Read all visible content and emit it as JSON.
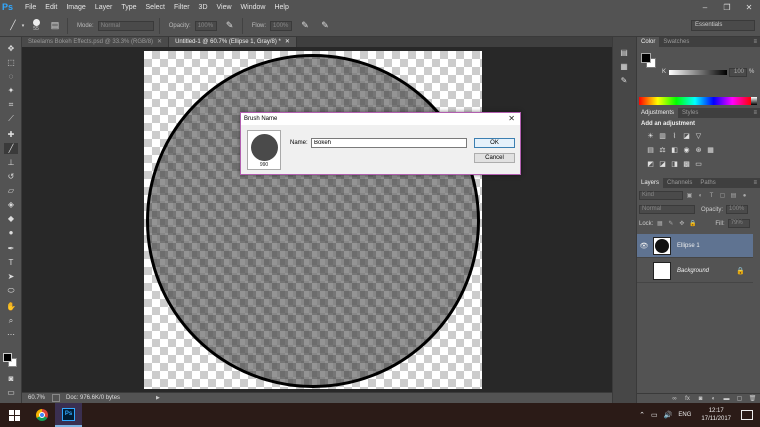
{
  "app": {
    "logo": "Ps",
    "menu": [
      "File",
      "Edit",
      "Image",
      "Layer",
      "Type",
      "Select",
      "Filter",
      "3D",
      "View",
      "Window",
      "Help"
    ],
    "window_controls": [
      "–",
      "❐",
      "✕"
    ]
  },
  "options": {
    "brush_size": "55",
    "mode_label": "Mode:",
    "mode_value": "Normal",
    "opacity_label": "Opacity:",
    "opacity_value": "100%",
    "flow_label": "Flow:",
    "flow_value": "100%",
    "workspace": "Essentials"
  },
  "tabs": [
    {
      "label": "Steelams Bokeh Effects.psd @ 33.3% (RGB/8)",
      "close": "✕"
    },
    {
      "label": "Untitled-1 @ 60.7% (Ellipse 1, Gray/8) *",
      "close": "✕"
    }
  ],
  "status": {
    "zoom": "60.7%",
    "doc": "Doc: 976.6K/0 bytes",
    "arrow": "▶"
  },
  "panels": {
    "color_tabs": [
      "Color",
      "Swatches"
    ],
    "color_k_label": "K",
    "color_k_value": "100",
    "color_pct": "%",
    "adj_tabs": [
      "Adjustments",
      "Styles"
    ],
    "adj_title": "Add an adjustment",
    "layers_tabs": [
      "Layers",
      "Channels",
      "Paths"
    ],
    "layers_kind": "Kind",
    "layers_blend": "Normal",
    "layers_opacity_label": "Opacity:",
    "layers_opacity_value": "100%",
    "layers_lock_label": "Lock:",
    "layers_fill_label": "Fill:",
    "layers_fill_value": "79%",
    "layers": [
      {
        "name": "Ellipse 1",
        "selected": true
      },
      {
        "name": "Background",
        "selected": false
      }
    ]
  },
  "dialog": {
    "title": "Brush Name",
    "close": "✕",
    "preview_size": "990",
    "name_label": "Name:",
    "name_value": "Bokeh",
    "ok_label": "OK",
    "cancel_label": "Cancel"
  },
  "taskbar": {
    "language": "ENG",
    "time": "12:17",
    "date": "17/11/2017"
  },
  "colors": {
    "app_bg": "#535353",
    "canvas_bg": "#282828",
    "selected_layer": "#5f7391",
    "dialog_border": "#b25fb0",
    "taskbar": "#2b1b17"
  }
}
